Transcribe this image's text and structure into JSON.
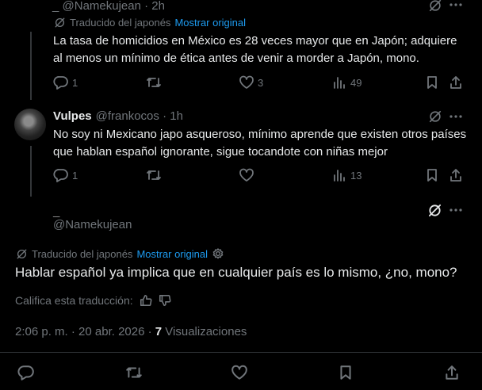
{
  "tweet1": {
    "author_line": "_ @Namekujean · 2h",
    "translated_label": "Traducido del japonés",
    "show_original": "Mostrar original",
    "text": "La tasa de homicidios en México es 28 veces mayor que en Japón; adquiere al menos un mínimo de ética antes de venir a morder a Japón, mono.",
    "replies": "1",
    "likes": "3",
    "views": "49"
  },
  "tweet2": {
    "name": "Vulpes",
    "handle_time": "@frankocos · 1h",
    "text": "No soy ni Mexicano japo asqueroso, mínimo aprende que existen otros países que hablan español ignorante, sigue tocandote con niñas mejor",
    "replies": "1",
    "views": "13"
  },
  "main": {
    "name": "_",
    "handle": "@Namekujean",
    "translated_label": "Traducido del japonés",
    "show_original": "Mostrar original",
    "text": "Hablar español ya implica que en cualquier país es lo mismo, ¿no, mono?",
    "rate_label": "Califica esta traducción:",
    "time": "2:06 p. m. · 20 abr. 2026 · ",
    "views_count": "7",
    "views_label": " Visualizaciones"
  },
  "icons": {
    "more": "more-dots-icon",
    "grok": "grok-icon",
    "reply": "reply-icon",
    "retweet": "retweet-icon",
    "like": "like-icon",
    "views": "views-icon",
    "bookmark": "bookmark-icon",
    "share": "share-icon",
    "translate": "translate-icon",
    "settings": "gear-icon",
    "thumbs_up": "thumbs-up-icon",
    "thumbs_down": "thumbs-down-icon"
  },
  "colors": {
    "background": "#000000",
    "text": "#e7e9ea",
    "muted": "#71767b",
    "link": "#1d9bf0"
  }
}
